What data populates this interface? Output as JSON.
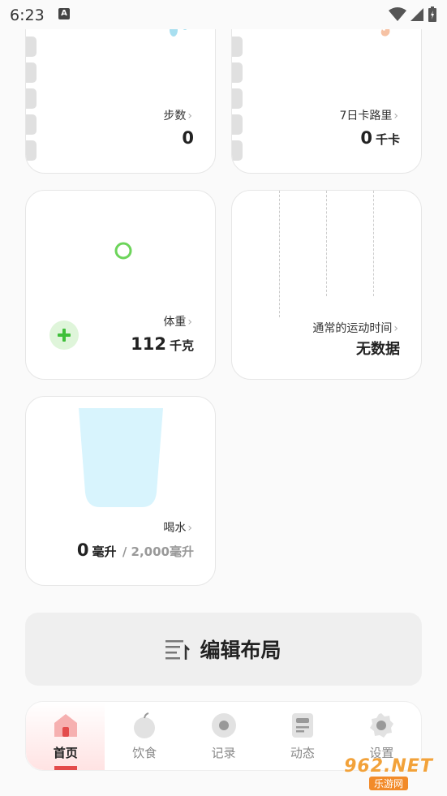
{
  "status_bar": {
    "time": "6:23",
    "notification_letter": "A"
  },
  "cards": {
    "steps": {
      "title": "步数",
      "value": "0"
    },
    "calories": {
      "title": "7日卡路里",
      "value": "0",
      "unit": "千卡"
    },
    "weight": {
      "title": "体重",
      "value": "112",
      "unit": "千克"
    },
    "exercise": {
      "title": "通常的运动时间",
      "value": "无数据"
    },
    "water": {
      "title": "喝水",
      "value": "0",
      "unit": "毫升",
      "goal": "/ 2,000毫升"
    }
  },
  "edit_layout": {
    "label": "编辑布局"
  },
  "bottom_nav": {
    "items": [
      {
        "label": "首页",
        "icon": "home-icon",
        "active": true
      },
      {
        "label": "饮食",
        "icon": "apple-icon",
        "active": false
      },
      {
        "label": "记录",
        "icon": "record-icon",
        "active": false
      },
      {
        "label": "动态",
        "icon": "document-icon",
        "active": false
      },
      {
        "label": "设置",
        "icon": "gear-icon",
        "active": false
      }
    ]
  },
  "watermark": {
    "top": "962.NET",
    "bottom": "乐游网"
  },
  "colors": {
    "accent_red": "#e34b4b",
    "weight_green": "#6cd45a",
    "water_blue": "#d8f4fd"
  }
}
